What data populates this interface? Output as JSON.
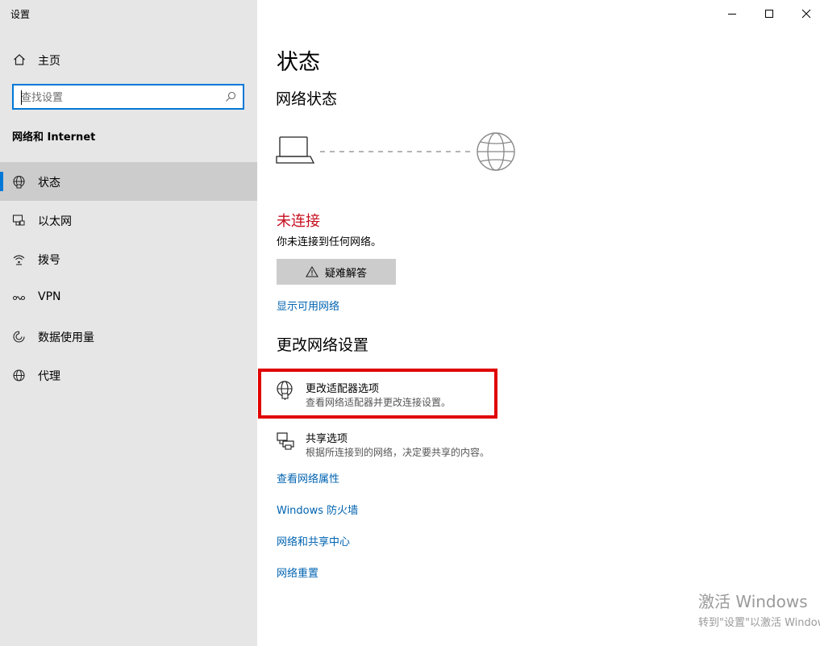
{
  "window": {
    "title": "设置",
    "controls": {
      "minimize": "minimize",
      "maximize": "maximize",
      "close": "close"
    }
  },
  "sidebar": {
    "home_label": "主页",
    "search_placeholder": "查找设置",
    "section_title": "网络和 Internet",
    "items": [
      {
        "label": "状态",
        "icon": "globe-status-icon",
        "active": true
      },
      {
        "label": "以太网",
        "icon": "ethernet-icon",
        "active": false
      },
      {
        "label": "拨号",
        "icon": "dialup-icon",
        "active": false
      },
      {
        "label": "VPN",
        "icon": "vpn-icon",
        "active": false
      },
      {
        "label": "数据使用量",
        "icon": "data-usage-icon",
        "active": false
      },
      {
        "label": "代理",
        "icon": "proxy-globe-icon",
        "active": false
      }
    ]
  },
  "main": {
    "title": "状态",
    "network_status_heading": "网络状态",
    "status_title": "未连接",
    "status_desc": "你未连接到任何网络。",
    "troubleshoot_label": "疑难解答",
    "show_networks_link": "显示可用网络",
    "change_heading": "更改网络设置",
    "options": [
      {
        "title": "更改适配器选项",
        "desc": "查看网络适配器并更改连接设置。",
        "icon": "adapter-globe-icon"
      },
      {
        "title": "共享选项",
        "desc": "根据所连接到的网络，决定要共享的内容。",
        "icon": "sharing-printer-icon"
      }
    ],
    "links": [
      "查看网络属性",
      "Windows 防火墙",
      "网络和共享中心",
      "网络重置"
    ]
  },
  "watermark": {
    "line1": "激活 Windows",
    "line2": "转到\"设置\"以激活 Windows。"
  },
  "colors": {
    "accent": "#0078d7",
    "link": "#0063b1",
    "error": "#c50f1f",
    "highlight_box": "#e00000",
    "sidebar_bg": "#e6e6e6"
  }
}
